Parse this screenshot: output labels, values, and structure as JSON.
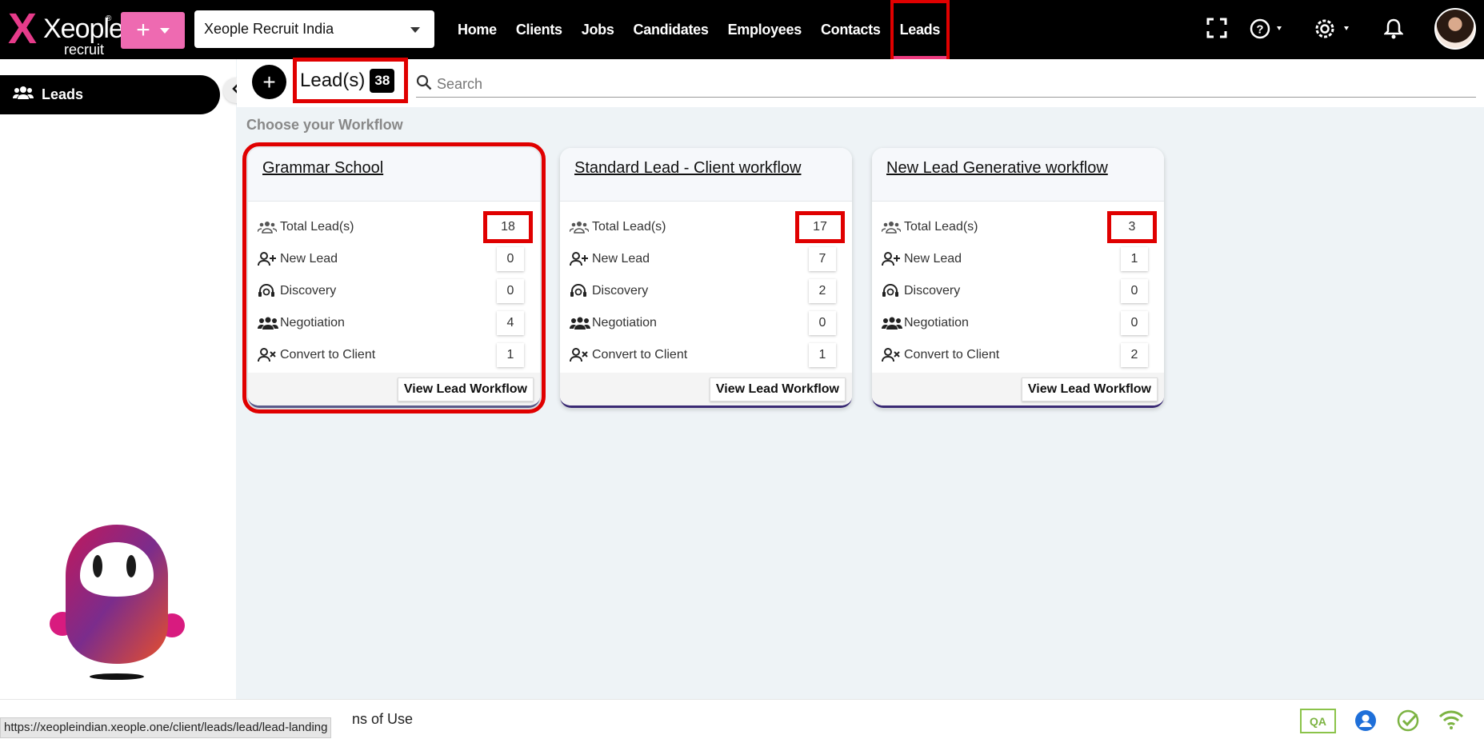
{
  "header": {
    "logo_text": "Xeople",
    "logo_sub": "recruit",
    "company": "Xeople Recruit India",
    "nav": [
      "Home",
      "Clients",
      "Jobs",
      "Candidates",
      "Employees",
      "Contacts",
      "Leads"
    ],
    "active_nav": "Leads"
  },
  "sidebar": {
    "item_label": "Leads"
  },
  "page": {
    "title": "Lead(s)",
    "count": "38",
    "search_placeholder": "Search",
    "section_label": "Choose your Workflow"
  },
  "cards": [
    {
      "title": "Grammar School",
      "rows": [
        {
          "label": "Total Lead(s)",
          "value": "18"
        },
        {
          "label": "New Lead",
          "value": "0"
        },
        {
          "label": "Discovery",
          "value": "0"
        },
        {
          "label": "Negotiation",
          "value": "4"
        },
        {
          "label": "Convert to Client",
          "value": "1"
        }
      ],
      "button": "View Lead Workflow"
    },
    {
      "title": "Standard Lead - Client workflow",
      "rows": [
        {
          "label": "Total Lead(s)",
          "value": "17"
        },
        {
          "label": "New Lead",
          "value": "7"
        },
        {
          "label": "Discovery",
          "value": "2"
        },
        {
          "label": "Negotiation",
          "value": "0"
        },
        {
          "label": "Convert to Client",
          "value": "1"
        }
      ],
      "button": "View Lead Workflow"
    },
    {
      "title": "New Lead Generative workflow",
      "rows": [
        {
          "label": "Total Lead(s)",
          "value": "3"
        },
        {
          "label": "New Lead",
          "value": "1"
        },
        {
          "label": "Discovery",
          "value": "0"
        },
        {
          "label": "Negotiation",
          "value": "0"
        },
        {
          "label": "Convert to Client",
          "value": "2"
        }
      ],
      "button": "View Lead Workflow"
    }
  ],
  "footer": {
    "terms_fragment": "ns of Use",
    "status_url": "https://xeopleindian.xeople.one/client/leads/lead/lead-landing",
    "env_badge": "QA"
  },
  "colors": {
    "accent_pink": "#ee6ab1",
    "highlight_red": "#e00000",
    "topbar": "#000000"
  }
}
